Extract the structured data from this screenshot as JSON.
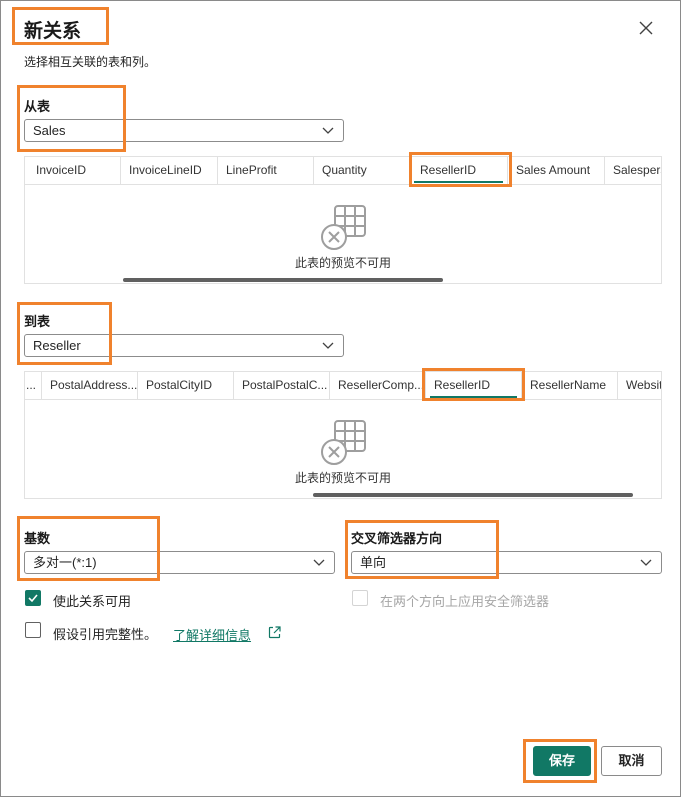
{
  "dialog": {
    "title": "新关系",
    "subtitle": "选择相互关联的表和列。"
  },
  "from_table": {
    "label": "从表",
    "selected": "Sales",
    "columns": [
      "InvoiceID",
      "InvoiceLineID",
      "LineProfit",
      "Quantity",
      "ResellerID",
      "Sales Amount",
      "Salespers"
    ],
    "selected_column": "ResellerID",
    "preview_empty_text": "此表的预览不可用"
  },
  "to_table": {
    "label": "到表",
    "selected": "Reseller",
    "columns": [
      "...",
      "PostalAddress...",
      "PostalCityID",
      "PostalPostalC...",
      "ResellerComp...",
      "ResellerID",
      "ResellerName",
      "Websit"
    ],
    "selected_column": "ResellerID",
    "preview_empty_text": "此表的预览不可用"
  },
  "cardinality": {
    "label": "基数",
    "selected": "多对一(*:1)"
  },
  "cross_filter": {
    "label": "交叉筛选器方向",
    "selected": "单向"
  },
  "options": {
    "make_active": {
      "label": "使此关系可用",
      "checked": true
    },
    "security_filter": {
      "label": "在两个方向上应用安全筛选器",
      "checked": false,
      "disabled": true
    },
    "referential_integrity": {
      "label": "假设引用完整性。",
      "checked": false
    },
    "learn_more": "了解详细信息"
  },
  "footer": {
    "save": "保存",
    "cancel": "取消"
  },
  "colors": {
    "accent": "#117865",
    "highlight": "#f0822d"
  }
}
